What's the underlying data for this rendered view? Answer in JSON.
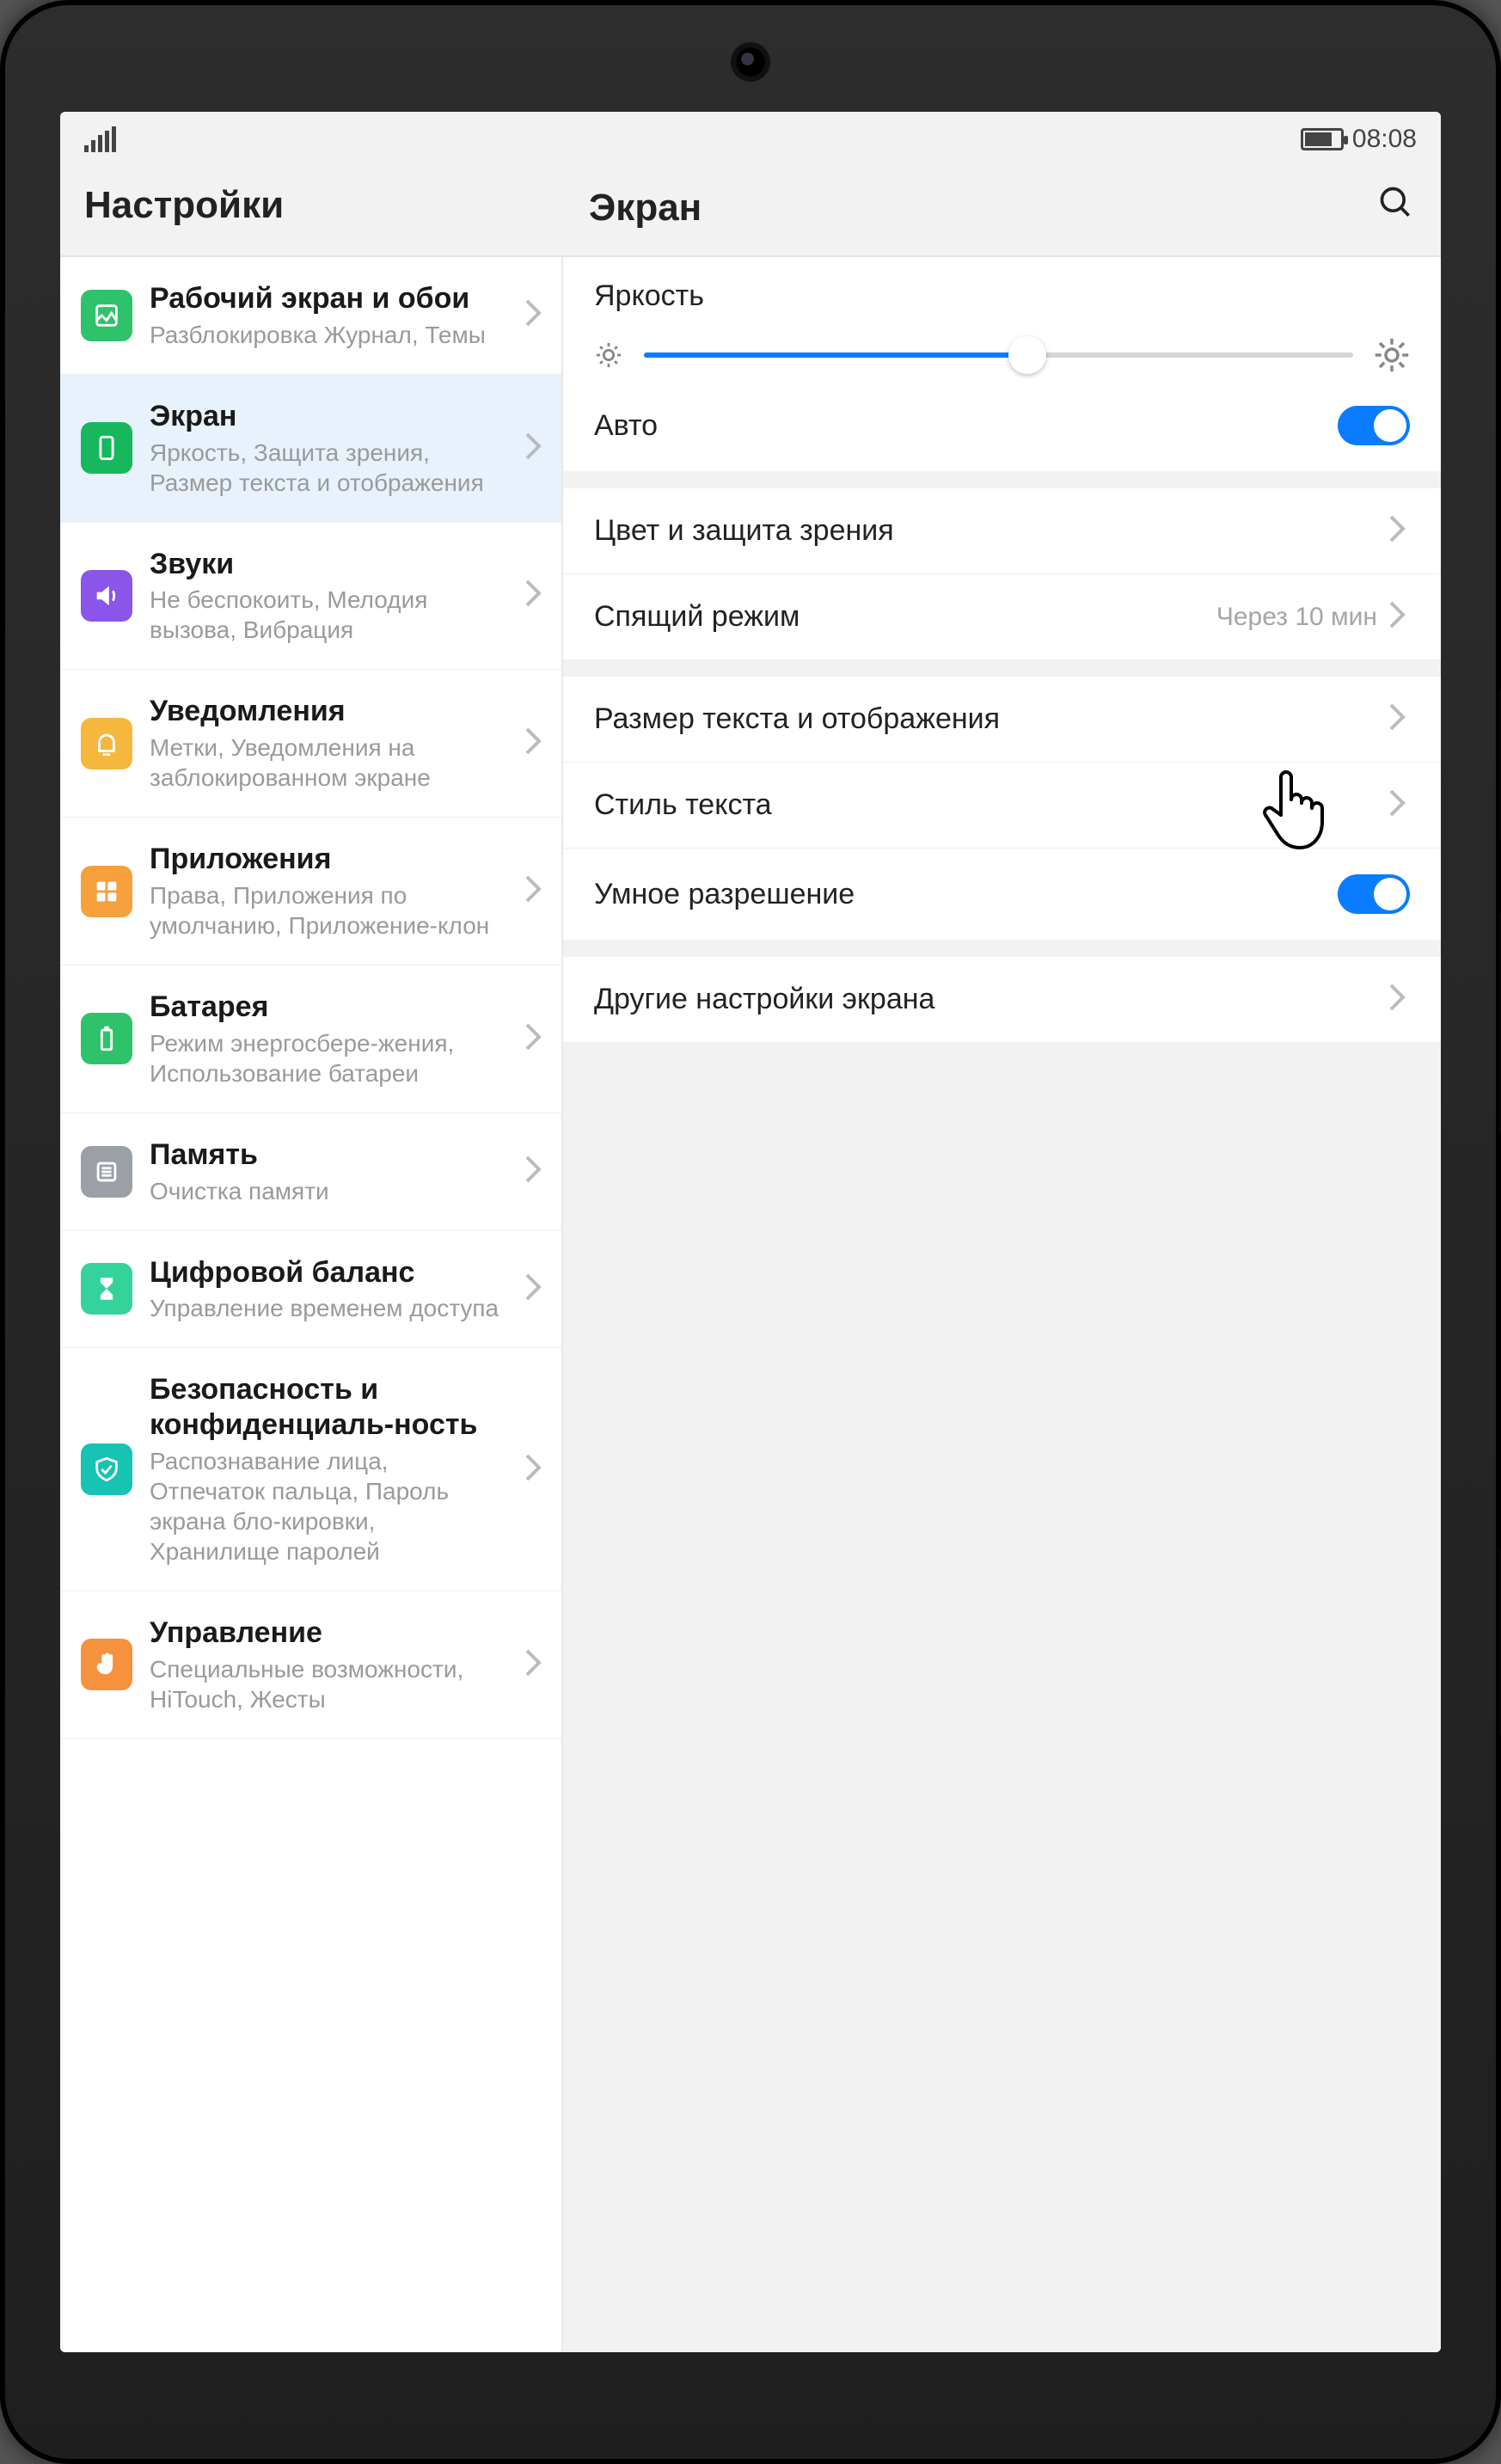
{
  "status": {
    "time": "08:08"
  },
  "sidebar": {
    "title": "Настройки",
    "items": [
      {
        "title": "Рабочий экран и обои",
        "sub": "Разблокировка Журнал, Темы"
      },
      {
        "title": "Экран",
        "sub": "Яркость, Защита зрения, Размер текста и отображения"
      },
      {
        "title": "Звуки",
        "sub": "Не беспокоить, Мелодия вызова, Вибрация"
      },
      {
        "title": "Уведомления",
        "sub": "Метки, Уведомления на заблокированном экране"
      },
      {
        "title": "Приложения",
        "sub": "Права, Приложения по умолчанию, Приложение-клон"
      },
      {
        "title": "Батарея",
        "sub": "Режим энергосбере-жения, Использование батареи"
      },
      {
        "title": "Память",
        "sub": "Очистка памяти"
      },
      {
        "title": "Цифровой баланс",
        "sub": "Управление временем доступа"
      },
      {
        "title": "Безопасность и конфиденциаль-ность",
        "sub": "Распознавание лица, Отпечаток пальца, Пароль экрана бло-кировки, Хранилище паролей"
      },
      {
        "title": "Управление",
        "sub": "Специальные возможности, HiTouch, Жесты"
      }
    ]
  },
  "main": {
    "title": "Экран",
    "brightness": {
      "label": "Яркость",
      "auto_label": "Авто",
      "value_pct": 54
    },
    "rows": {
      "eye_protection": "Цвет и защита зрения",
      "sleep": {
        "label": "Спящий режим",
        "value": "Через 10 мин"
      },
      "text_size": "Размер текста и отображения",
      "text_style": "Стиль текста",
      "smart_res": "Умное разрешение",
      "other": "Другие настройки экрана"
    }
  }
}
